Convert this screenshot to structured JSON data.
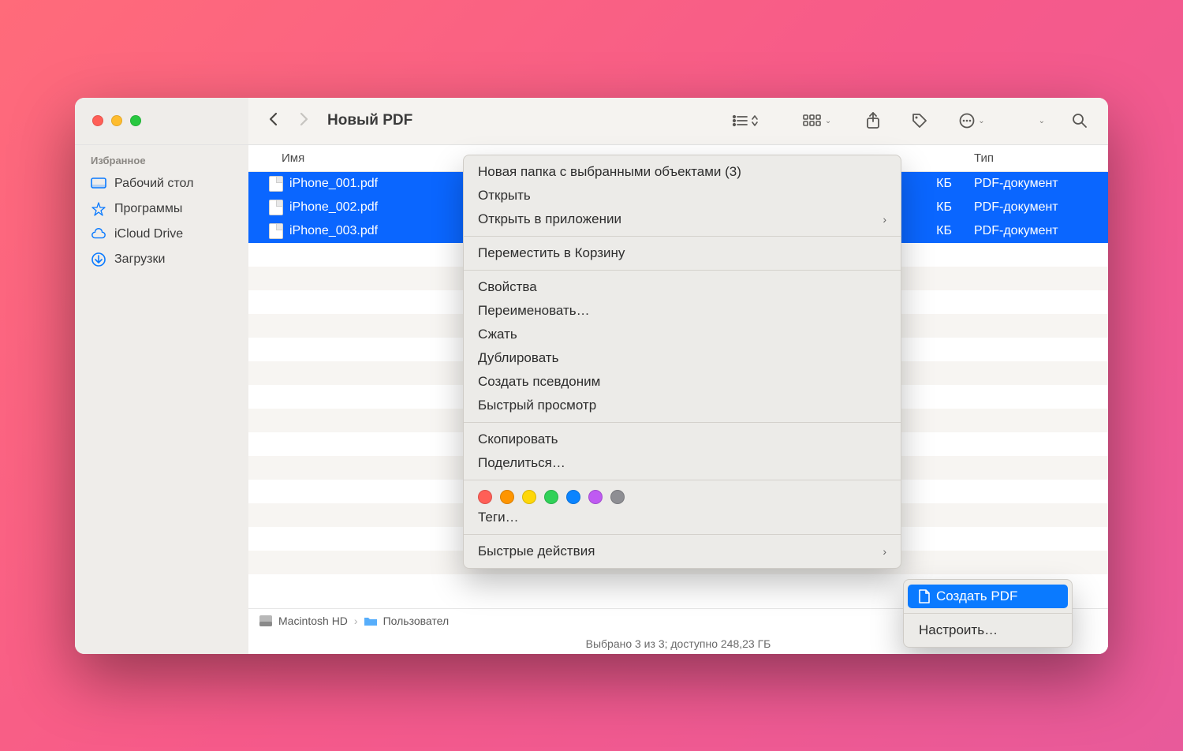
{
  "title": "Новый PDF",
  "sidebar": {
    "heading": "Избранное",
    "items": [
      {
        "label": "Рабочий стол"
      },
      {
        "label": "Программы"
      },
      {
        "label": "iCloud Drive"
      },
      {
        "label": "Загрузки"
      }
    ]
  },
  "columns": {
    "name": "Имя",
    "size": "",
    "type": "Тип"
  },
  "files": [
    {
      "name": "iPhone_001.pdf",
      "size": "КБ",
      "type": "PDF-документ"
    },
    {
      "name": "iPhone_002.pdf",
      "size": "КБ",
      "type": "PDF-документ"
    },
    {
      "name": "iPhone_003.pdf",
      "size": "КБ",
      "type": "PDF-документ"
    }
  ],
  "path": {
    "root": "Macintosh HD",
    "users": "Пользовател"
  },
  "status": "Выбрано 3 из 3; доступно 248,23 ГБ",
  "context_menu": {
    "new_folder": "Новая папка с выбранными объектами (3)",
    "open": "Открыть",
    "open_with": "Открыть в приложении",
    "trash": "Переместить в Корзину",
    "info": "Свойства",
    "rename": "Переименовать…",
    "compress": "Сжать",
    "duplicate": "Дублировать",
    "alias": "Создать псевдоним",
    "quicklook": "Быстрый просмотр",
    "copy": "Скопировать",
    "share": "Поделиться…",
    "tags_more": "Теги…",
    "quick_actions": "Быстрые действия"
  },
  "tag_colors": [
    "#ff5f57",
    "#fe9500",
    "#fed709",
    "#30d158",
    "#0a84ff",
    "#bf5af2",
    "#8e8e93"
  ],
  "submenu": {
    "create_pdf": "Создать PDF",
    "customize": "Настроить…"
  }
}
